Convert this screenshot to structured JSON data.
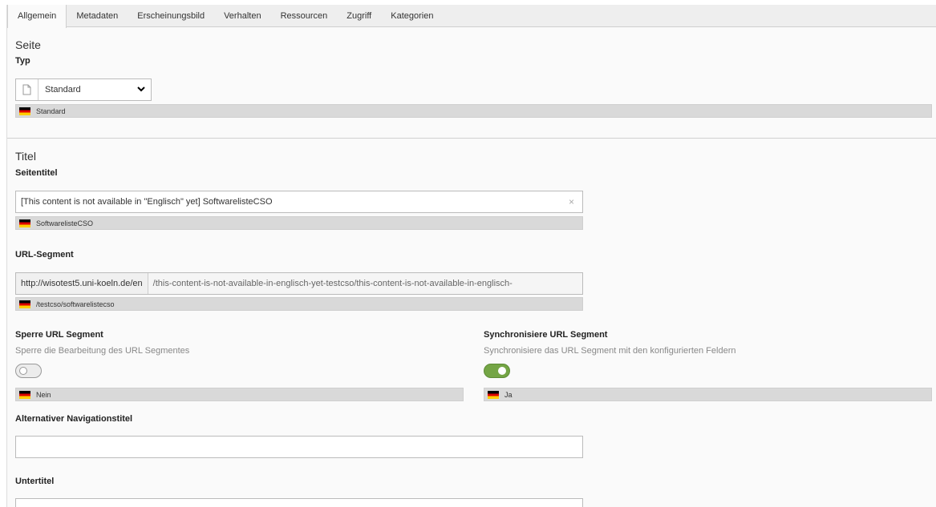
{
  "tabs": [
    "Allgemein",
    "Metadaten",
    "Erscheinungsbild",
    "Verhalten",
    "Ressourcen",
    "Zugriff",
    "Kategorien"
  ],
  "active_tab": "Allgemein",
  "seite": {
    "heading": "Seite",
    "typ_label": "Typ",
    "typ_value": "Standard",
    "typ_icon": "page-icon",
    "typ_default": "Standard"
  },
  "titel": {
    "heading": "Titel",
    "seitentitel_label": "Seitentitel",
    "seitentitel_value": "[This content is not available in \"Englisch\" yet] SoftwarelisteCSO",
    "seitentitel_clear": "×",
    "seitentitel_default": "SoftwarelisteCSO",
    "url_label": "URL-Segment",
    "url_prefix": "http://wisotest5.uni-koeln.de/en",
    "url_value": "/this-content-is-not-available-in-englisch-yet-testcso/this-content-is-not-available-in-englisch-",
    "url_default": "/testcso/softwarelistecso",
    "sperre_label": "Sperre URL Segment",
    "sperre_desc": "Sperre die Bearbeitung des URL Segmentes",
    "sperre_on": false,
    "sperre_default": "Nein",
    "sync_label": "Synchronisiere URL Segment",
    "sync_desc": "Synchronisiere das URL Segment mit den konfigurierten Feldern",
    "sync_on": true,
    "sync_default": "Ja",
    "nav_label": "Alternativer Navigationstitel",
    "nav_value": "",
    "untertitel_label": "Untertitel",
    "untertitel_value": ""
  },
  "colors": {
    "toggle_on": "#74a545",
    "diff_bar": "#d9d9d9",
    "flag_black": "#000000",
    "flag_red": "#dd0000",
    "flag_gold": "#ffce00"
  }
}
